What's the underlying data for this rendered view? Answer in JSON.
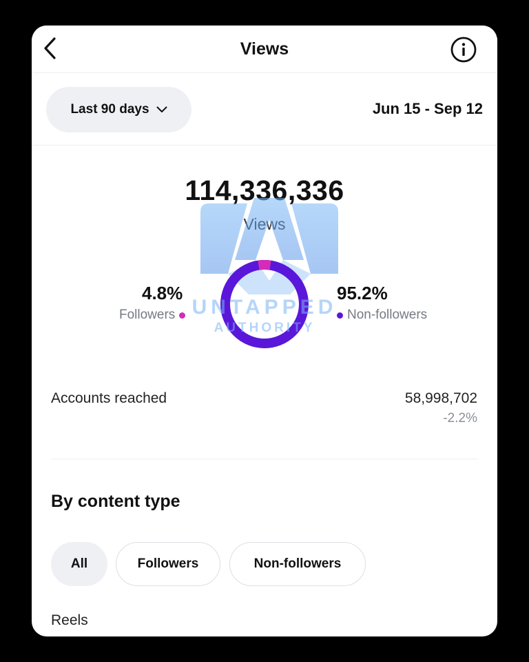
{
  "header": {
    "title": "Views"
  },
  "range": {
    "label": "Last 90 days",
    "dates": "Jun 15 - Sep 12"
  },
  "summary": {
    "total": "114,336,336",
    "caption": "Views",
    "followers_pct": "4.8%",
    "followers_label": "Followers",
    "nonfollowers_pct": "95.2%",
    "nonfollowers_label": "Non-followers",
    "followers_share": 4.8,
    "nonfollowers_share": 95.2
  },
  "accounts": {
    "label": "Accounts reached",
    "value": "58,998,702",
    "change": "-2.2%"
  },
  "content": {
    "title": "By content type",
    "chips": [
      "All",
      "Followers",
      "Non-followers"
    ],
    "first_item": "Reels"
  },
  "watermark": {
    "line1": "UNTAPPED",
    "line2": "AUTHORITY"
  },
  "colors": {
    "followers": "#d42bb8",
    "nonfollowers": "#5a17d9"
  }
}
